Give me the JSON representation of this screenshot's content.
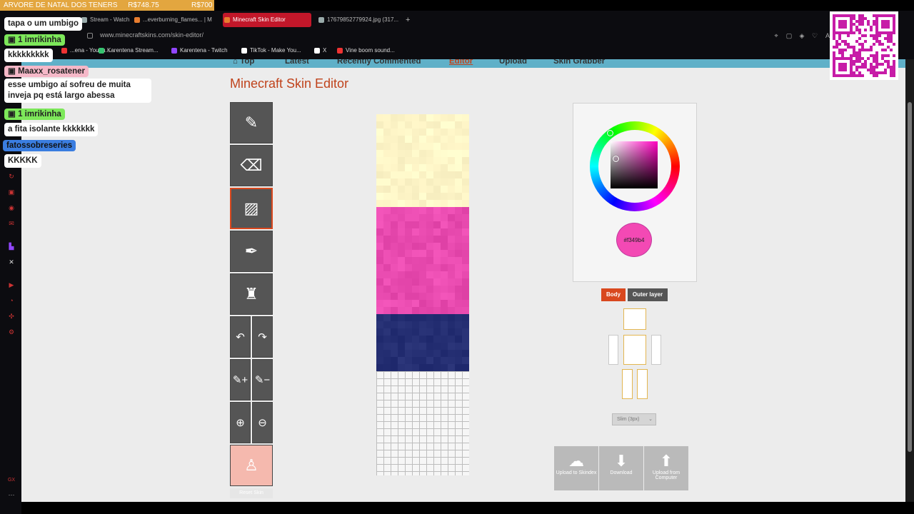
{
  "stream_goal": {
    "label": "ARVORE DE NATAL DOS TENERS",
    "current": "R$748.75",
    "target": "R$700"
  },
  "browser": {
    "tabs": [
      {
        "label": "Stream - Watch",
        "color": "#9aa"
      },
      {
        "label": "...everburning_flames... | M",
        "color": "#e87d2f"
      },
      {
        "label": "Minecraft Skin Editor",
        "color": "#e87d2f"
      },
      {
        "label": "17679852779924.jpg (317...",
        "color": "#9aa"
      }
    ],
    "new_tab": "+",
    "url": "www.minecraftskins.com/skin-editor/",
    "bookmarks": [
      {
        "label": "...ena - YouTu...",
        "color": "#e33"
      },
      {
        "label": "Karentena Stream...",
        "color": "#36c36f"
      },
      {
        "label": "Karentena - Twitch",
        "color": "#9146ff"
      },
      {
        "label": "TikTok - Make You...",
        "color": "#fff"
      },
      {
        "label": "X",
        "color": "#fff"
      },
      {
        "label": "Vine boom sound...",
        "color": "#e33"
      }
    ]
  },
  "site": {
    "nav": [
      "Top",
      "Latest",
      "Recently Commented",
      "Editor",
      "Upload",
      "Skin Grabber"
    ],
    "active_nav": "Editor",
    "page_title": "Minecraft Skin Editor"
  },
  "tools": [
    {
      "name": "pencil-tool",
      "icon": "pencil-icon",
      "glyph": "✎"
    },
    {
      "name": "eraser-tool",
      "icon": "eraser-icon",
      "glyph": "⌫"
    },
    {
      "name": "shade-tool",
      "icon": "shade-brush-icon",
      "glyph": "🖌"
    },
    {
      "name": "eyedropper-tool",
      "icon": "eyedropper-icon",
      "glyph": "✒"
    },
    {
      "name": "bucket-tool",
      "icon": "paint-bucket-icon",
      "glyph": "🪣"
    }
  ],
  "undo_redo": {
    "undo": "↶",
    "redo": "↷"
  },
  "brush_size": {
    "increase": "✎+",
    "decrease": "✎−"
  },
  "zoom": {
    "in": "⊕",
    "out": "⊖"
  },
  "reset_skin": "Reset Skin",
  "color": {
    "hex": "#f349b4",
    "label": "#f349b4"
  },
  "layers": {
    "body": "Body",
    "outer": "Outer layer"
  },
  "model_select": "Slim (3px)",
  "actions": [
    {
      "label": "Upload to Skindex",
      "icon": "upload-skindex-icon",
      "glyph": "☁"
    },
    {
      "label": "Download",
      "icon": "download-icon",
      "glyph": "⬇"
    },
    {
      "label": "Upload from Computer",
      "icon": "upload-computer-icon",
      "glyph": "⬆"
    }
  ],
  "chat": [
    {
      "type": "message",
      "text": "tapa o um umbigo"
    },
    {
      "type": "message",
      "text": "kkkkkkkkk"
    },
    {
      "type": "user",
      "name": "imrikinha",
      "badge": "1",
      "color": "#7de85a"
    },
    {
      "type": "user",
      "name": "Maaxx_rosatener",
      "color": "#f5b8c8"
    },
    {
      "type": "message",
      "text": "esse umbigo aí sofreu de muita inveja pq está largo abessa"
    },
    {
      "type": "user",
      "name": "imrikinha",
      "badge": "1",
      "color": "#7de85a"
    },
    {
      "type": "message",
      "text": "a fita isolante kkkkkkk"
    },
    {
      "type": "user",
      "name": "fatossobreseries",
      "color": "#3a7de0"
    },
    {
      "type": "message",
      "text": "KKKKK"
    }
  ],
  "colors": {
    "cream": "#fff6c8",
    "pink": "#e94bb0",
    "navy": "#252f73",
    "accent": "#c0431c",
    "body_btn": "#d9481e",
    "outer_btn": "#555555"
  }
}
